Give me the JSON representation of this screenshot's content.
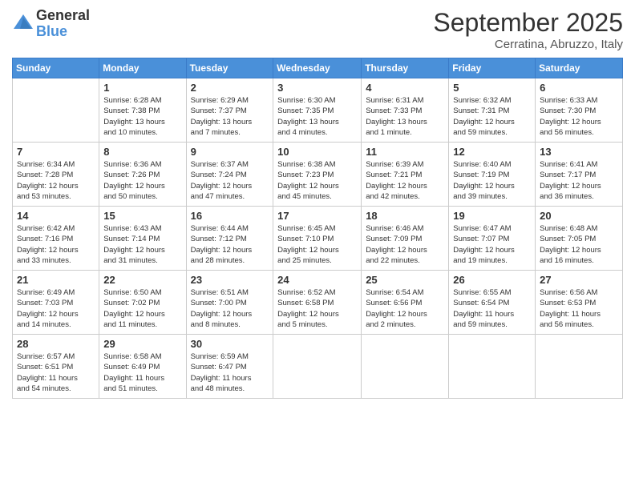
{
  "header": {
    "logo_general": "General",
    "logo_blue": "Blue",
    "month": "September 2025",
    "location": "Cerratina, Abruzzo, Italy"
  },
  "weekdays": [
    "Sunday",
    "Monday",
    "Tuesday",
    "Wednesday",
    "Thursday",
    "Friday",
    "Saturday"
  ],
  "weeks": [
    [
      {
        "day": "",
        "text": ""
      },
      {
        "day": "1",
        "text": "Sunrise: 6:28 AM\nSunset: 7:38 PM\nDaylight: 13 hours\nand 10 minutes."
      },
      {
        "day": "2",
        "text": "Sunrise: 6:29 AM\nSunset: 7:37 PM\nDaylight: 13 hours\nand 7 minutes."
      },
      {
        "day": "3",
        "text": "Sunrise: 6:30 AM\nSunset: 7:35 PM\nDaylight: 13 hours\nand 4 minutes."
      },
      {
        "day": "4",
        "text": "Sunrise: 6:31 AM\nSunset: 7:33 PM\nDaylight: 13 hours\nand 1 minute."
      },
      {
        "day": "5",
        "text": "Sunrise: 6:32 AM\nSunset: 7:31 PM\nDaylight: 12 hours\nand 59 minutes."
      },
      {
        "day": "6",
        "text": "Sunrise: 6:33 AM\nSunset: 7:30 PM\nDaylight: 12 hours\nand 56 minutes."
      }
    ],
    [
      {
        "day": "7",
        "text": "Sunrise: 6:34 AM\nSunset: 7:28 PM\nDaylight: 12 hours\nand 53 minutes."
      },
      {
        "day": "8",
        "text": "Sunrise: 6:36 AM\nSunset: 7:26 PM\nDaylight: 12 hours\nand 50 minutes."
      },
      {
        "day": "9",
        "text": "Sunrise: 6:37 AM\nSunset: 7:24 PM\nDaylight: 12 hours\nand 47 minutes."
      },
      {
        "day": "10",
        "text": "Sunrise: 6:38 AM\nSunset: 7:23 PM\nDaylight: 12 hours\nand 45 minutes."
      },
      {
        "day": "11",
        "text": "Sunrise: 6:39 AM\nSunset: 7:21 PM\nDaylight: 12 hours\nand 42 minutes."
      },
      {
        "day": "12",
        "text": "Sunrise: 6:40 AM\nSunset: 7:19 PM\nDaylight: 12 hours\nand 39 minutes."
      },
      {
        "day": "13",
        "text": "Sunrise: 6:41 AM\nSunset: 7:17 PM\nDaylight: 12 hours\nand 36 minutes."
      }
    ],
    [
      {
        "day": "14",
        "text": "Sunrise: 6:42 AM\nSunset: 7:16 PM\nDaylight: 12 hours\nand 33 minutes."
      },
      {
        "day": "15",
        "text": "Sunrise: 6:43 AM\nSunset: 7:14 PM\nDaylight: 12 hours\nand 31 minutes."
      },
      {
        "day": "16",
        "text": "Sunrise: 6:44 AM\nSunset: 7:12 PM\nDaylight: 12 hours\nand 28 minutes."
      },
      {
        "day": "17",
        "text": "Sunrise: 6:45 AM\nSunset: 7:10 PM\nDaylight: 12 hours\nand 25 minutes."
      },
      {
        "day": "18",
        "text": "Sunrise: 6:46 AM\nSunset: 7:09 PM\nDaylight: 12 hours\nand 22 minutes."
      },
      {
        "day": "19",
        "text": "Sunrise: 6:47 AM\nSunset: 7:07 PM\nDaylight: 12 hours\nand 19 minutes."
      },
      {
        "day": "20",
        "text": "Sunrise: 6:48 AM\nSunset: 7:05 PM\nDaylight: 12 hours\nand 16 minutes."
      }
    ],
    [
      {
        "day": "21",
        "text": "Sunrise: 6:49 AM\nSunset: 7:03 PM\nDaylight: 12 hours\nand 14 minutes."
      },
      {
        "day": "22",
        "text": "Sunrise: 6:50 AM\nSunset: 7:02 PM\nDaylight: 12 hours\nand 11 minutes."
      },
      {
        "day": "23",
        "text": "Sunrise: 6:51 AM\nSunset: 7:00 PM\nDaylight: 12 hours\nand 8 minutes."
      },
      {
        "day": "24",
        "text": "Sunrise: 6:52 AM\nSunset: 6:58 PM\nDaylight: 12 hours\nand 5 minutes."
      },
      {
        "day": "25",
        "text": "Sunrise: 6:54 AM\nSunset: 6:56 PM\nDaylight: 12 hours\nand 2 minutes."
      },
      {
        "day": "26",
        "text": "Sunrise: 6:55 AM\nSunset: 6:54 PM\nDaylight: 11 hours\nand 59 minutes."
      },
      {
        "day": "27",
        "text": "Sunrise: 6:56 AM\nSunset: 6:53 PM\nDaylight: 11 hours\nand 56 minutes."
      }
    ],
    [
      {
        "day": "28",
        "text": "Sunrise: 6:57 AM\nSunset: 6:51 PM\nDaylight: 11 hours\nand 54 minutes."
      },
      {
        "day": "29",
        "text": "Sunrise: 6:58 AM\nSunset: 6:49 PM\nDaylight: 11 hours\nand 51 minutes."
      },
      {
        "day": "30",
        "text": "Sunrise: 6:59 AM\nSunset: 6:47 PM\nDaylight: 11 hours\nand 48 minutes."
      },
      {
        "day": "",
        "text": ""
      },
      {
        "day": "",
        "text": ""
      },
      {
        "day": "",
        "text": ""
      },
      {
        "day": "",
        "text": ""
      }
    ]
  ]
}
